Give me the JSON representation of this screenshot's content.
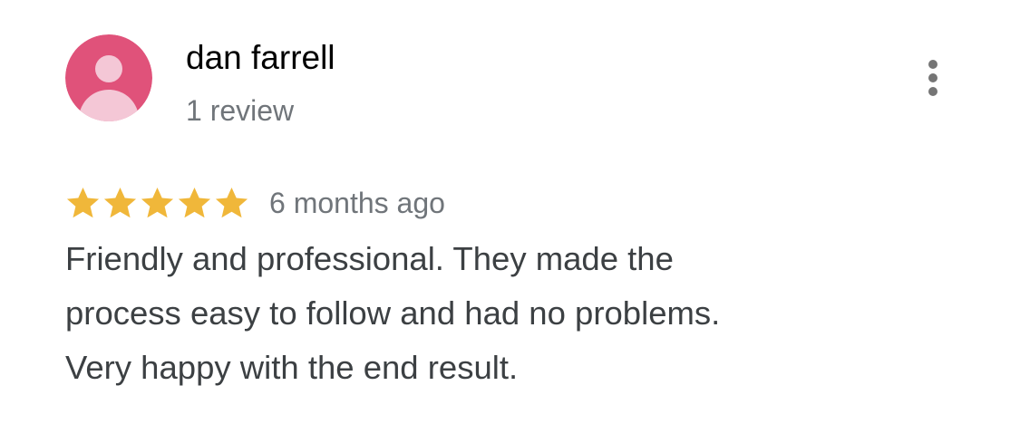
{
  "reviewer": {
    "name": "dan farrell",
    "review_count": "1 review",
    "avatar_color": "#e0527a",
    "avatar_figure_color": "#f4c7d6"
  },
  "rating": {
    "stars": 5,
    "max_stars": 5,
    "star_color": "#f0b73a",
    "date": "6 months ago"
  },
  "review": {
    "lines": [
      "Friendly and professional. They made the",
      "process easy to follow and had no problems.",
      "Very happy with the end result."
    ]
  },
  "menu": {
    "icon": "more-vertical-icon",
    "icon_color": "#757575"
  }
}
